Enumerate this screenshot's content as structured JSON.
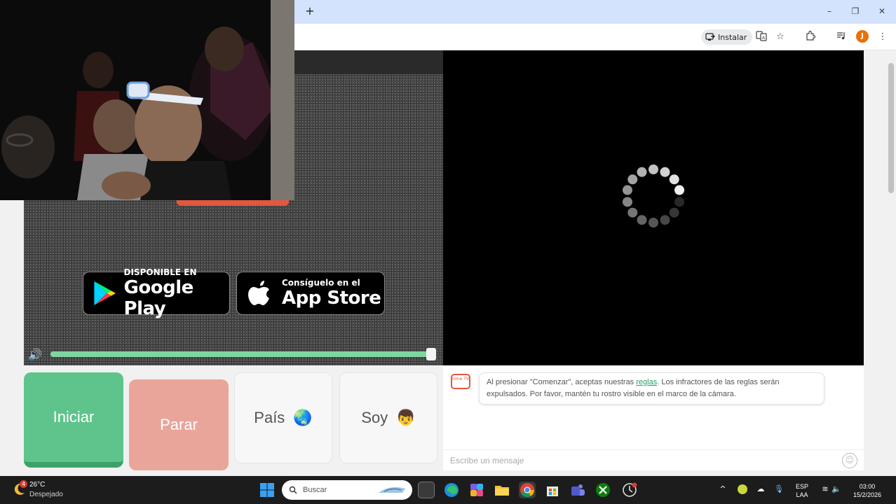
{
  "browser": {
    "new_tab_symbol": "+",
    "window_controls": {
      "minimize": "–",
      "restore": "❐",
      "close": "✕"
    },
    "install_label": "Instalar",
    "profile_initial": "J"
  },
  "store_buttons": {
    "google": {
      "small": "DISPONIBLE EN",
      "big": "Google Play"
    },
    "apple": {
      "small": "Consíguelo en el",
      "big": "App Store"
    }
  },
  "volume": {
    "level_fraction": 1.0
  },
  "buttons": {
    "start": "Iniciar",
    "stop": "Parar",
    "country": "País",
    "country_emoji": "🌏",
    "gender": "Soy",
    "gender_emoji": "👦"
  },
  "chat": {
    "logo_text": "Ome TV",
    "notice_before": "Al presionar \"Comenzar\", aceptas nuestras ",
    "notice_link": "reglas",
    "notice_after": ". Los infractores de las reglas serán expulsados. Por favor, mantén tu rostro visible en el marco de la cámara.",
    "input_placeholder": "Escribe un mensaje"
  },
  "taskbar": {
    "weather_temp": "26°C",
    "weather_desc": "Despejado",
    "weather_badge": "4",
    "search_placeholder": "Buscar",
    "lang_line1": "ESP",
    "lang_line2": "LAA",
    "time": "03:00",
    "date": "15/2/2026"
  },
  "colors": {
    "accent_green": "#5ec48c",
    "stop_salmon": "#eaa59a",
    "brand_red": "#e05a44",
    "link_green": "#2f9c6a"
  }
}
